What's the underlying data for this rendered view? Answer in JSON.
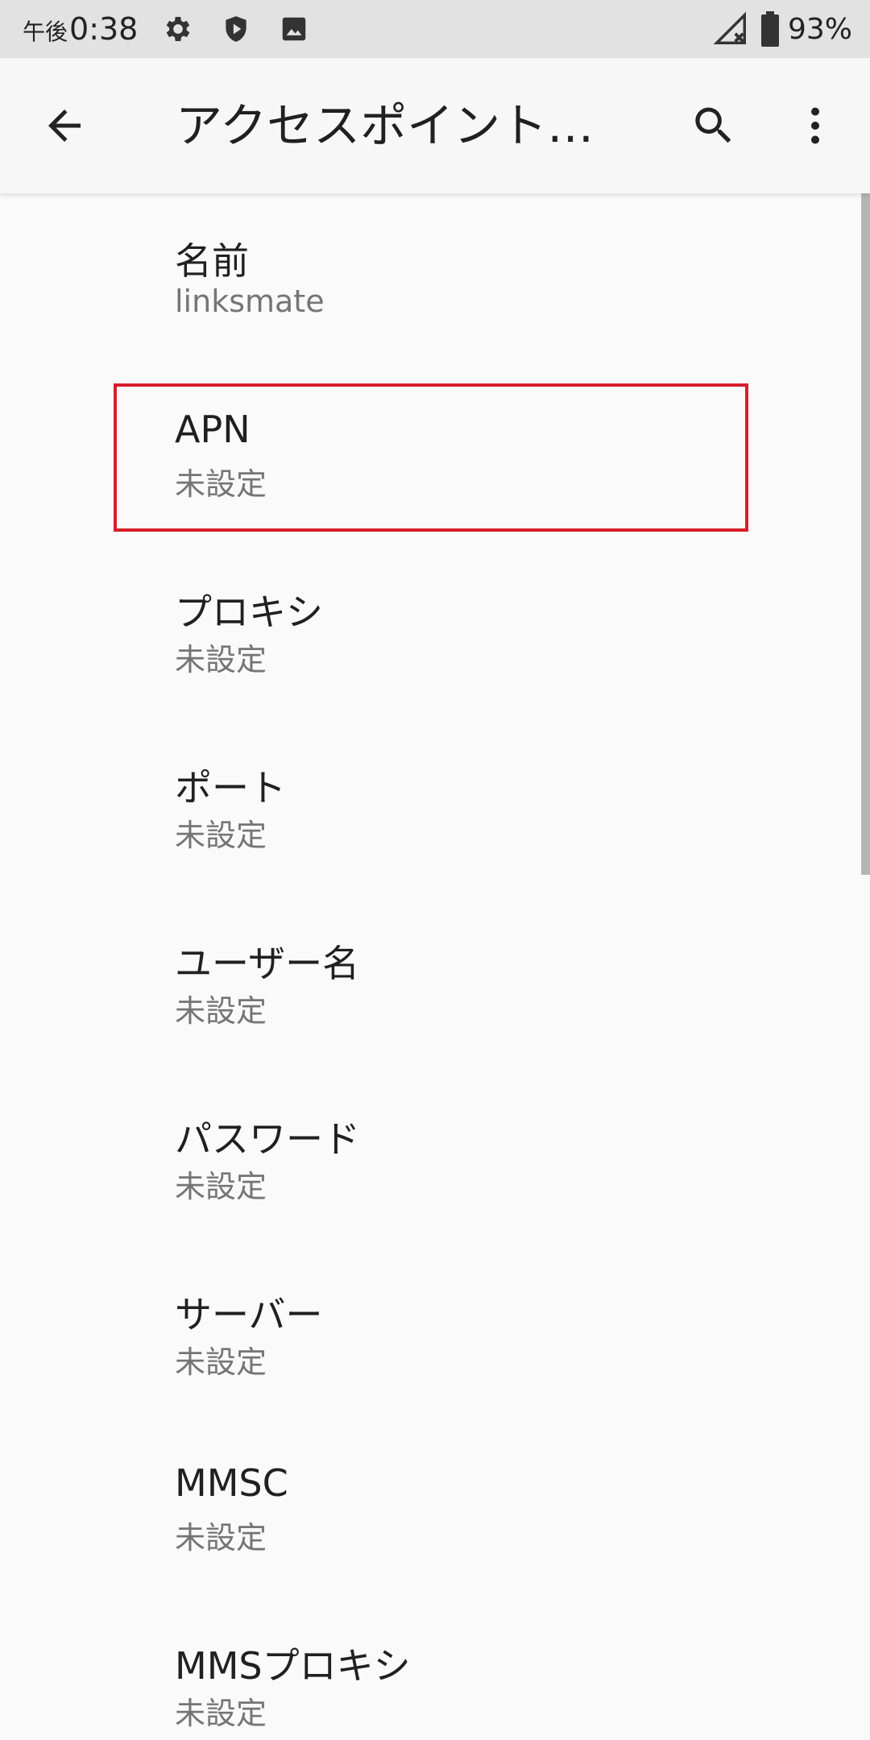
{
  "status_bar": {
    "time_prefix": "午後",
    "time": "0:38",
    "battery": "93%",
    "icons": [
      "gear-icon",
      "shield-play-icon",
      "image-icon",
      "signal-off-icon",
      "battery-icon"
    ]
  },
  "toolbar": {
    "title": "アクセスポイント…",
    "icons": [
      "back-arrow-icon",
      "search-icon",
      "more-vert-icon"
    ]
  },
  "preferences": [
    {
      "title": "名前",
      "summary": "linksmate"
    },
    {
      "title": "APN",
      "summary": "未設定",
      "highlighted": true
    },
    {
      "title": "プロキシ",
      "summary": "未設定"
    },
    {
      "title": "ポート",
      "summary": "未設定"
    },
    {
      "title": "ユーザー名",
      "summary": "未設定"
    },
    {
      "title": "パスワード",
      "summary": "未設定"
    },
    {
      "title": "サーバー",
      "summary": "未設定"
    },
    {
      "title": "MMSC",
      "summary": "未設定"
    },
    {
      "title": "MMSプロキシ",
      "summary": "未設定"
    }
  ],
  "colors": {
    "highlight": "#d81e2c",
    "status_bar_bg": "#e2e2e2",
    "background": "#fafafa"
  }
}
